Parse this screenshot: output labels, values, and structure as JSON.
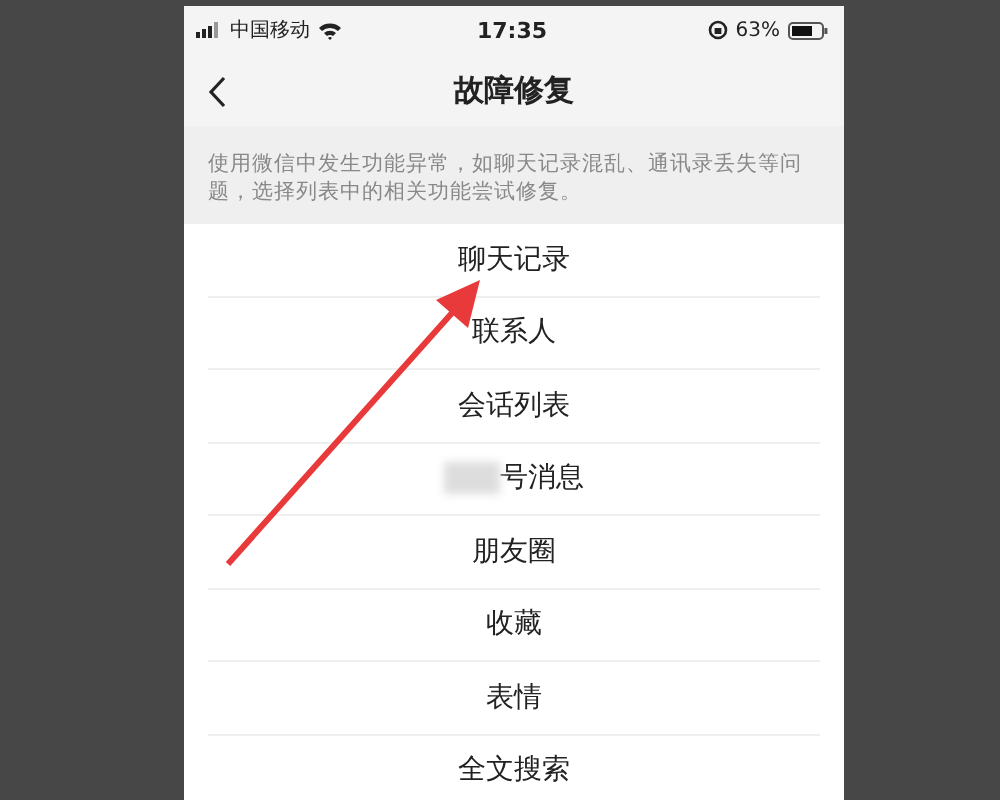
{
  "status_bar": {
    "carrier": "中国移动",
    "time": "17:35",
    "battery": "63%"
  },
  "nav": {
    "title": "故障修复"
  },
  "description": "使用微信中发生功能异常，如聊天记录混乱、通讯录丢失等问题，选择列表中的相关功能尝试修复。",
  "items": [
    {
      "label": "聊天记录",
      "blurred": false
    },
    {
      "label": "联系人",
      "blurred": false
    },
    {
      "label": "会话列表",
      "blurred": false
    },
    {
      "label": "号消息",
      "blurred": true
    },
    {
      "label": "朋友圈",
      "blurred": false
    },
    {
      "label": "收藏",
      "blurred": false
    },
    {
      "label": "表情",
      "blurred": false
    },
    {
      "label": "全文搜索",
      "blurred": false
    }
  ]
}
